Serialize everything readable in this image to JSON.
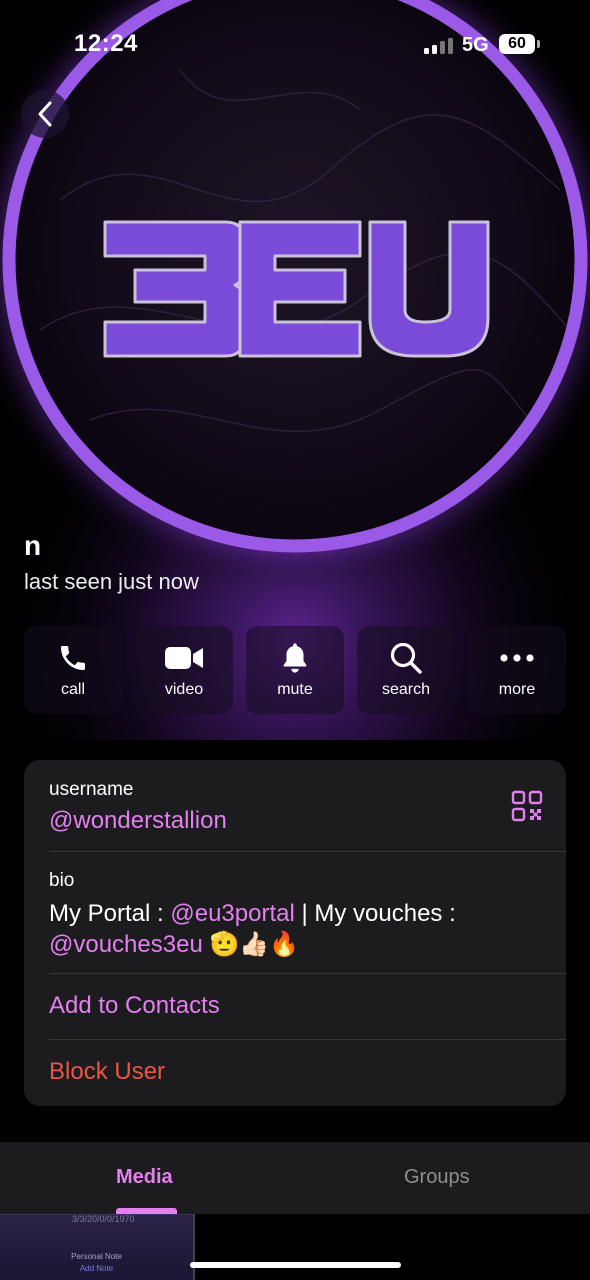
{
  "status_bar": {
    "time": "12:24",
    "network": "5G",
    "battery": "60"
  },
  "profile": {
    "name": "n",
    "status": "last seen just now",
    "avatar_text": "3EU"
  },
  "actions": [
    {
      "label": "call",
      "icon": "phone-icon"
    },
    {
      "label": "video",
      "icon": "video-camera-icon"
    },
    {
      "label": "mute",
      "icon": "bell-icon"
    },
    {
      "label": "search",
      "icon": "magnifier-icon"
    },
    {
      "label": "more",
      "icon": "ellipsis-icon"
    }
  ],
  "info": {
    "username_label": "username",
    "username": "@wonderstallion",
    "bio_label": "bio",
    "bio_prefix": "My Portal : ",
    "bio_link1": "@eu3portal",
    "bio_middle": " | My vouches : ",
    "bio_link2": "@vouches3eu",
    "bio_emojis": "🫡👍🏻🔥",
    "add_contacts": "Add to Contacts",
    "block_user": "Block User"
  },
  "tabs": [
    {
      "label": "Media",
      "active": true
    },
    {
      "label": "Groups",
      "active": false
    }
  ],
  "media_preview": {
    "top_text": "3/3/20/0/0/1970",
    "title": "Personal Note",
    "subtitle": "Add Note"
  },
  "colors": {
    "accent": "#e47ff0",
    "danger": "#eb5545",
    "ring": "#9b59e8",
    "card": "#1c1c1e"
  }
}
